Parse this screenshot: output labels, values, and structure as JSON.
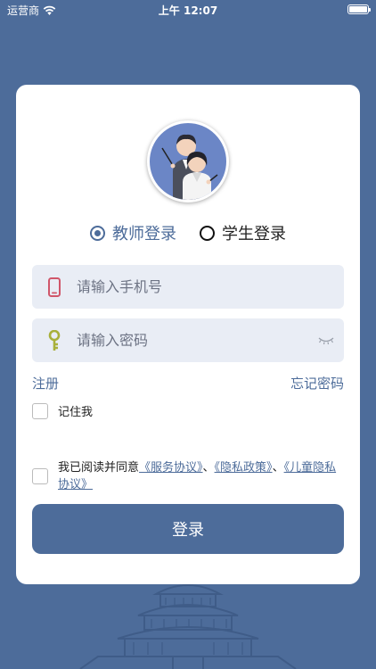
{
  "status_bar": {
    "carrier": "运营商",
    "time": "上午 12:07"
  },
  "login": {
    "roles": [
      {
        "label": "教师登录",
        "selected": true
      },
      {
        "label": "学生登录",
        "selected": false
      }
    ],
    "phone_placeholder": "请输入手机号",
    "password_placeholder": "请输入密码",
    "register_label": "注册",
    "forgot_label": "忘记密码",
    "remember_label": "记住我",
    "agreement": {
      "prefix": "我已阅读并同意",
      "service": "《服务协议》",
      "sep1": "、",
      "privacy": "《隐私政策》",
      "sep2": "、",
      "child_privacy": "《儿童隐私协议》"
    },
    "login_button": "登录"
  },
  "colors": {
    "primary": "#4d6c9a",
    "field_bg": "#e9edf5",
    "phone_icon": "#d0566a",
    "key_icon": "#a8b03a"
  },
  "icons": [
    "wifi-icon",
    "battery-icon",
    "phone-icon",
    "key-icon",
    "eye-closed-icon"
  ]
}
